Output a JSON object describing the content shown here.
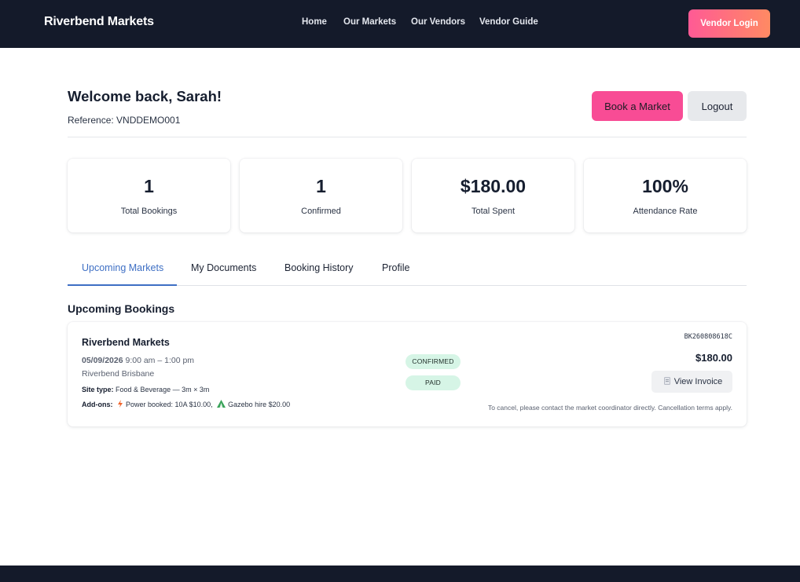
{
  "header": {
    "brand": "Riverbend Markets",
    "nav": [
      "Home",
      "Our Markets",
      "Our Vendors",
      "Vendor Guide"
    ],
    "login_label": "Vendor Login"
  },
  "dashboard": {
    "welcome": "Welcome back, Sarah!",
    "reference": "Reference: VNDDEMO001",
    "book_label": "Book a Market",
    "logout_label": "Logout"
  },
  "stats": [
    {
      "value": "1",
      "label": "Total Bookings"
    },
    {
      "value": "1",
      "label": "Confirmed"
    },
    {
      "value": "$180.00",
      "label": "Total Spent"
    },
    {
      "value": "100%",
      "label": "Attendance Rate"
    }
  ],
  "tabs": [
    {
      "label": "Upcoming Markets",
      "active": true
    },
    {
      "label": "My Documents",
      "active": false
    },
    {
      "label": "Booking History",
      "active": false
    },
    {
      "label": "Profile",
      "active": false
    }
  ],
  "section_title": "Upcoming Bookings",
  "booking": {
    "market": "Riverbend Markets",
    "date": "05/09/2026",
    "time": "9:00 am – 1:00 pm",
    "location": "Riverbend Brisbane",
    "site_type_label": "Site type:",
    "site_type": "Food & Beverage — 3m × 3m",
    "addons_label": "Add-ons:",
    "addons": [
      {
        "icon": "lightning-icon",
        "text": "Power booked: 10A $10.00,"
      },
      {
        "icon": "tent-icon",
        "text": "Gazebo hire $20.00"
      }
    ],
    "statuses": [
      "CONFIRMED",
      "PAID"
    ],
    "booking_ref": "BK260808618C",
    "price": "$180.00",
    "invoice_label": "View Invoice",
    "note": "To cancel, please contact the market coordinator directly. Cancellation terms apply."
  },
  "colors": {
    "nav_bg": "#141a2a",
    "accent_pink": "#f84c95",
    "tab_active": "#3e6fc4",
    "badge_bg": "#d6f5e6"
  }
}
